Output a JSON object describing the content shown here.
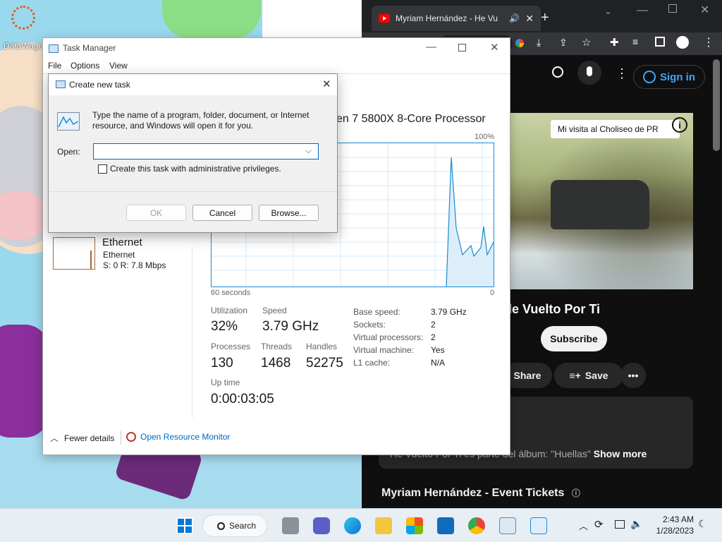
{
  "desktop": {
    "icon_label": "DataWago"
  },
  "chrome": {
    "tab_title": "Myriam Hernández - He Vu",
    "signin_label": "Sign in",
    "video_caption": "Mi visita al Choliseo de PR",
    "video_info": "i",
    "song_title": "le Vuelto Por Ti",
    "subscribe_label": "Subscribe",
    "share_label": "Share",
    "save_label": "Save",
    "more_label": "•••",
    "description": "He Vuelto Por Ti es parte del álbum: \"Huellas\"",
    "show_more_label": "Show more",
    "event_tickets": "Myriam Hernández - Event Tickets"
  },
  "task_manager": {
    "title": "Task Manager",
    "menu": [
      "File",
      "Options",
      "View"
    ],
    "processor": "yzen 7 5800X 8-Core Processor",
    "percent_max": "100%",
    "time_window": "60 seconds",
    "zero": "0",
    "ethernet": {
      "name": "Ethernet",
      "sub": "Ethernet",
      "rate": "S: 0 R: 7.8 Mbps"
    },
    "stats": {
      "utilization_label": "Utilization",
      "utilization": "32%",
      "speed_label": "Speed",
      "speed": "3.79 GHz",
      "processes_label": "Processes",
      "processes": "130",
      "threads_label": "Threads",
      "threads": "1468",
      "handles_label": "Handles",
      "handles": "52275",
      "uptime_label": "Up time",
      "uptime": "0:00:03:05"
    },
    "specs": [
      {
        "k": "Base speed:",
        "v": "3.79 GHz"
      },
      {
        "k": "Sockets:",
        "v": "2"
      },
      {
        "k": "Virtual processors:",
        "v": "2"
      },
      {
        "k": "Virtual machine:",
        "v": "Yes"
      },
      {
        "k": "L1 cache:",
        "v": "N/A"
      }
    ],
    "fewer_details": "Fewer details",
    "open_resource_monitor": "Open Resource Monitor"
  },
  "dialog": {
    "title": "Create new task",
    "description": "Type the name of a program, folder, document, or Internet resource, and Windows will open it for you.",
    "open_label": "Open:",
    "open_value": "",
    "admin_checkbox_label": "Create this task with administrative privileges.",
    "ok_label": "OK",
    "cancel_label": "Cancel",
    "browse_label": "Browse..."
  },
  "taskbar": {
    "search_label": "Search",
    "time": "2:43 AM",
    "date": "1/28/2023"
  },
  "colors": {
    "accent": "#0067c0",
    "cpu_line": "#1a8ad4",
    "youtube_red": "#ff0000"
  }
}
